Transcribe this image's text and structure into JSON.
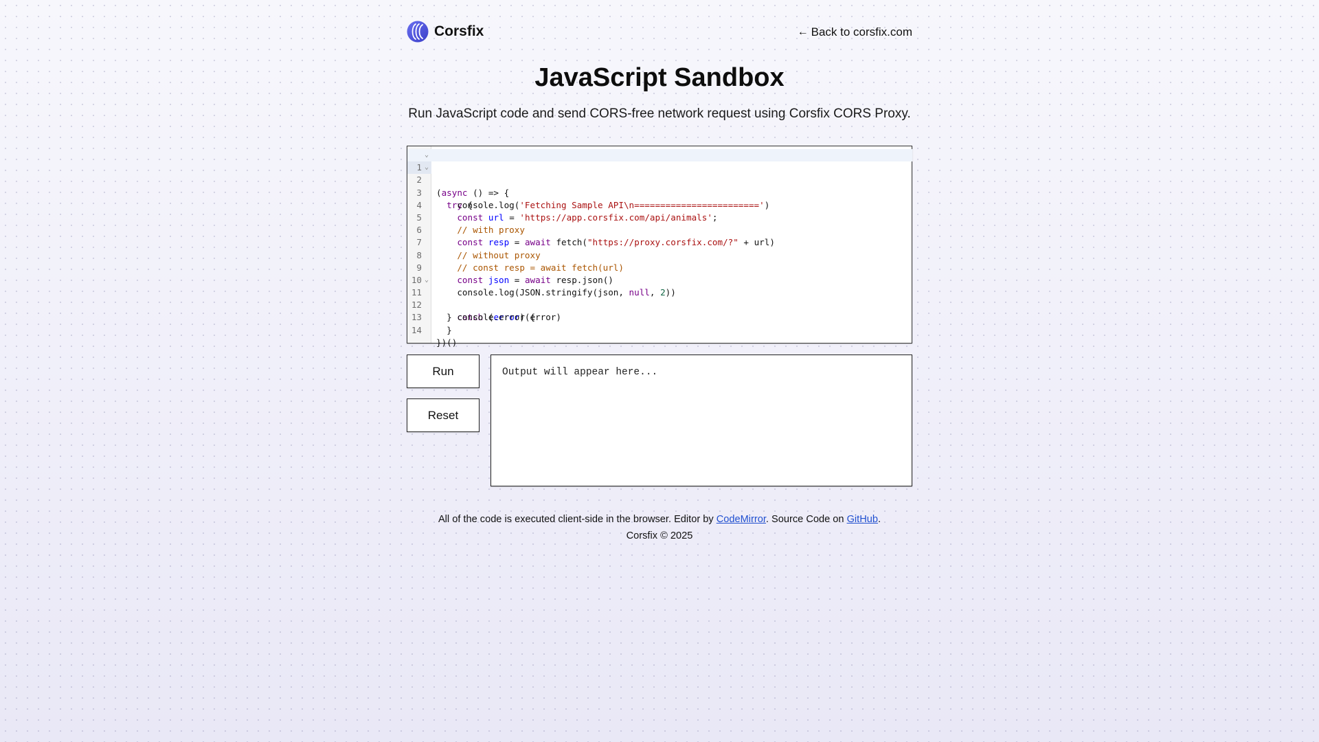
{
  "header": {
    "brand": "Corsfix",
    "back_arrow": "←",
    "back_link": "Back to corsfix.com"
  },
  "page": {
    "title": "JavaScript Sandbox",
    "subtitle": "Run JavaScript code and send CORS-free network request using Corsfix CORS Proxy."
  },
  "editor": {
    "line_numbers": [
      "1",
      "2",
      "3",
      "4",
      "5",
      "6",
      "7",
      "8",
      "9",
      "10",
      "11",
      "12",
      "13",
      "14"
    ],
    "fold_glyph": "⌄",
    "code": {
      "l1": {
        "a": "(",
        "b": "async",
        "c": " () => {"
      },
      "l2": {
        "a": "  ",
        "b": "try",
        "c": " {"
      },
      "l3": {
        "a": "    console.log(",
        "b": "'Fetching Sample API\\n========================'",
        "c": ")"
      },
      "l4": {
        "a": "    ",
        "b": "const",
        "c": " ",
        "d": "url",
        "e": " = ",
        "f": "'https://app.corsfix.com/api/animals'",
        "g": ";"
      },
      "l5": {
        "a": "    ",
        "b": "// with proxy"
      },
      "l6": {
        "a": "    ",
        "b": "const",
        "c": " ",
        "d": "resp",
        "e": " = ",
        "f": "await",
        "g": " fetch(",
        "h": "\"https://proxy.corsfix.com/?\"",
        "i": " + url)"
      },
      "l7": {
        "a": "    ",
        "b": "// without proxy"
      },
      "l8": {
        "a": "    ",
        "b": "// const resp = await fetch(url)"
      },
      "l9": {
        "a": "    ",
        "b": "const",
        "c": " ",
        "d": "json",
        "e": " = ",
        "f": "await",
        "g": " resp.json()"
      },
      "l10": {
        "a": "    console.log(JSON.stringify(json, ",
        "b": "null",
        "c": ", ",
        "d": "2",
        "e": "))"
      },
      "l11": {
        "a": "  } ",
        "b": "catch",
        "c": " (",
        "d": "error",
        "e": ") {"
      },
      "l12": {
        "a": "    console.error(error)"
      },
      "l13": {
        "a": "  }"
      },
      "l14": {
        "a": "})()"
      }
    }
  },
  "actions": {
    "run": "Run",
    "reset": "Reset"
  },
  "output": {
    "placeholder": "Output will appear here..."
  },
  "footer": {
    "text1": "All of the code is executed client-side in the browser. Editor by ",
    "codemirror": "CodeMirror",
    "text2": ". Source Code on ",
    "github": "GitHub",
    "text3": ".",
    "copyright": "Corsfix © 2025"
  },
  "colors": {
    "keyword": "#770088",
    "definition": "#0000ff",
    "string": "#aa1111",
    "comment": "#aa5500",
    "number": "#116644",
    "link": "#1f4fd0"
  },
  "icons": {
    "logo": "corsfix-logo-icon",
    "back": "arrow-left-icon"
  }
}
